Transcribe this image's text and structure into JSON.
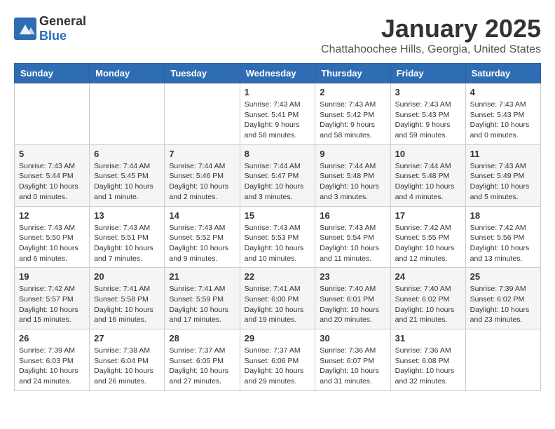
{
  "header": {
    "logo_general": "General",
    "logo_blue": "Blue",
    "title": "January 2025",
    "subtitle": "Chattahoochee Hills, Georgia, United States"
  },
  "days_of_week": [
    "Sunday",
    "Monday",
    "Tuesday",
    "Wednesday",
    "Thursday",
    "Friday",
    "Saturday"
  ],
  "weeks": [
    [
      {
        "day": "",
        "info": ""
      },
      {
        "day": "",
        "info": ""
      },
      {
        "day": "",
        "info": ""
      },
      {
        "day": "1",
        "info": "Sunrise: 7:43 AM\nSunset: 5:41 PM\nDaylight: 9 hours and 58 minutes."
      },
      {
        "day": "2",
        "info": "Sunrise: 7:43 AM\nSunset: 5:42 PM\nDaylight: 9 hours and 58 minutes."
      },
      {
        "day": "3",
        "info": "Sunrise: 7:43 AM\nSunset: 5:43 PM\nDaylight: 9 hours and 59 minutes."
      },
      {
        "day": "4",
        "info": "Sunrise: 7:43 AM\nSunset: 5:43 PM\nDaylight: 10 hours and 0 minutes."
      }
    ],
    [
      {
        "day": "5",
        "info": "Sunrise: 7:43 AM\nSunset: 5:44 PM\nDaylight: 10 hours and 0 minutes."
      },
      {
        "day": "6",
        "info": "Sunrise: 7:44 AM\nSunset: 5:45 PM\nDaylight: 10 hours and 1 minute."
      },
      {
        "day": "7",
        "info": "Sunrise: 7:44 AM\nSunset: 5:46 PM\nDaylight: 10 hours and 2 minutes."
      },
      {
        "day": "8",
        "info": "Sunrise: 7:44 AM\nSunset: 5:47 PM\nDaylight: 10 hours and 3 minutes."
      },
      {
        "day": "9",
        "info": "Sunrise: 7:44 AM\nSunset: 5:48 PM\nDaylight: 10 hours and 3 minutes."
      },
      {
        "day": "10",
        "info": "Sunrise: 7:44 AM\nSunset: 5:48 PM\nDaylight: 10 hours and 4 minutes."
      },
      {
        "day": "11",
        "info": "Sunrise: 7:43 AM\nSunset: 5:49 PM\nDaylight: 10 hours and 5 minutes."
      }
    ],
    [
      {
        "day": "12",
        "info": "Sunrise: 7:43 AM\nSunset: 5:50 PM\nDaylight: 10 hours and 6 minutes."
      },
      {
        "day": "13",
        "info": "Sunrise: 7:43 AM\nSunset: 5:51 PM\nDaylight: 10 hours and 7 minutes."
      },
      {
        "day": "14",
        "info": "Sunrise: 7:43 AM\nSunset: 5:52 PM\nDaylight: 10 hours and 9 minutes."
      },
      {
        "day": "15",
        "info": "Sunrise: 7:43 AM\nSunset: 5:53 PM\nDaylight: 10 hours and 10 minutes."
      },
      {
        "day": "16",
        "info": "Sunrise: 7:43 AM\nSunset: 5:54 PM\nDaylight: 10 hours and 11 minutes."
      },
      {
        "day": "17",
        "info": "Sunrise: 7:42 AM\nSunset: 5:55 PM\nDaylight: 10 hours and 12 minutes."
      },
      {
        "day": "18",
        "info": "Sunrise: 7:42 AM\nSunset: 5:56 PM\nDaylight: 10 hours and 13 minutes."
      }
    ],
    [
      {
        "day": "19",
        "info": "Sunrise: 7:42 AM\nSunset: 5:57 PM\nDaylight: 10 hours and 15 minutes."
      },
      {
        "day": "20",
        "info": "Sunrise: 7:41 AM\nSunset: 5:58 PM\nDaylight: 10 hours and 16 minutes."
      },
      {
        "day": "21",
        "info": "Sunrise: 7:41 AM\nSunset: 5:59 PM\nDaylight: 10 hours and 17 minutes."
      },
      {
        "day": "22",
        "info": "Sunrise: 7:41 AM\nSunset: 6:00 PM\nDaylight: 10 hours and 19 minutes."
      },
      {
        "day": "23",
        "info": "Sunrise: 7:40 AM\nSunset: 6:01 PM\nDaylight: 10 hours and 20 minutes."
      },
      {
        "day": "24",
        "info": "Sunrise: 7:40 AM\nSunset: 6:02 PM\nDaylight: 10 hours and 21 minutes."
      },
      {
        "day": "25",
        "info": "Sunrise: 7:39 AM\nSunset: 6:02 PM\nDaylight: 10 hours and 23 minutes."
      }
    ],
    [
      {
        "day": "26",
        "info": "Sunrise: 7:39 AM\nSunset: 6:03 PM\nDaylight: 10 hours and 24 minutes."
      },
      {
        "day": "27",
        "info": "Sunrise: 7:38 AM\nSunset: 6:04 PM\nDaylight: 10 hours and 26 minutes."
      },
      {
        "day": "28",
        "info": "Sunrise: 7:37 AM\nSunset: 6:05 PM\nDaylight: 10 hours and 27 minutes."
      },
      {
        "day": "29",
        "info": "Sunrise: 7:37 AM\nSunset: 6:06 PM\nDaylight: 10 hours and 29 minutes."
      },
      {
        "day": "30",
        "info": "Sunrise: 7:36 AM\nSunset: 6:07 PM\nDaylight: 10 hours and 31 minutes."
      },
      {
        "day": "31",
        "info": "Sunrise: 7:36 AM\nSunset: 6:08 PM\nDaylight: 10 hours and 32 minutes."
      },
      {
        "day": "",
        "info": ""
      }
    ]
  ]
}
